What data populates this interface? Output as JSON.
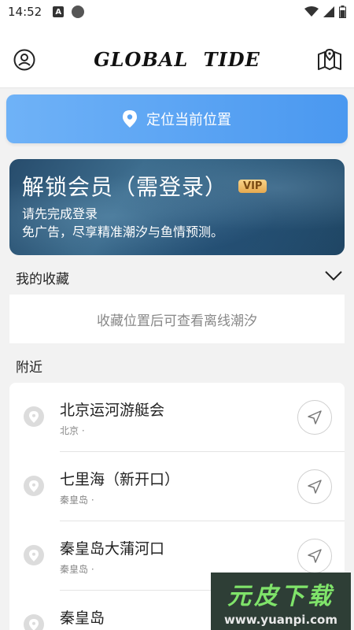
{
  "status_bar": {
    "time": "14:52",
    "notification_icon": "A",
    "icons": [
      "wifi-icon",
      "signal-icon",
      "battery-icon"
    ]
  },
  "header": {
    "title": "GLOBAL TIDE",
    "left_icon": "profile-icon",
    "right_icon": "map-icon"
  },
  "locate": {
    "label": "定位当前位置",
    "icon": "location-pin-icon"
  },
  "vip_card": {
    "title": "解锁会员（需登录）",
    "badge": "VIP",
    "line1": "请先完成登录",
    "line2": "免广告，尽享精准潮汐与鱼情预测。"
  },
  "favorites": {
    "label": "我的收藏",
    "empty_text": "收藏位置后可查看离线潮汐"
  },
  "nearby": {
    "label": "附近",
    "items": [
      {
        "name": "北京运河游艇会",
        "sub": "北京 ·"
      },
      {
        "name": "七里海（新开口）",
        "sub": "秦皇岛 ·"
      },
      {
        "name": "秦皇岛大蒲河口",
        "sub": "秦皇岛 ·"
      },
      {
        "name": "秦皇岛",
        "sub": ""
      }
    ]
  },
  "watermark": {
    "big": "元皮下载",
    "small": "www.yuanpi.com"
  },
  "colors": {
    "accent": "#4a98f0",
    "vip_badge": "#e6a94f",
    "background": "#f2f2f2"
  }
}
